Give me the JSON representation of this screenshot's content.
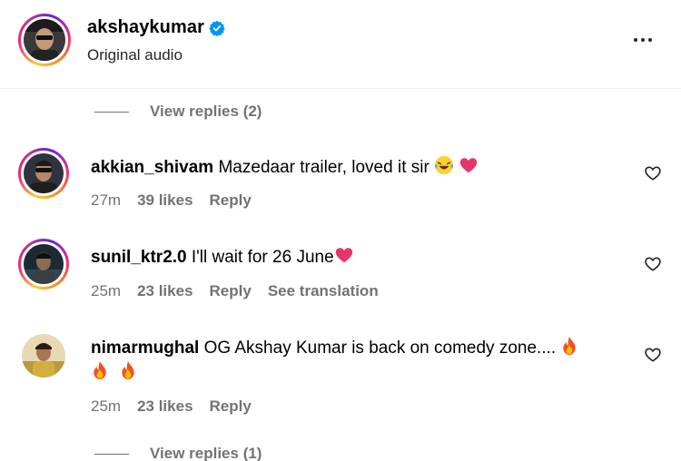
{
  "post": {
    "author": "akshaykumar",
    "subtitle": "Original audio"
  },
  "top_view_replies": "View replies (2)",
  "comments": [
    {
      "username": "akkian_shivam",
      "text": "Mazedaar trailer, loved it sir",
      "emojis": [
        "laughing-emoji",
        "heart-emoji"
      ],
      "time": "27m",
      "likes": "39 likes",
      "reply": "Reply"
    },
    {
      "username": "sunil_ktr2.0",
      "text": "I'll wait for 26 June",
      "emojis": [
        "heart-emoji"
      ],
      "time": "25m",
      "likes": "23 likes",
      "reply": "Reply",
      "translation": "See translation"
    },
    {
      "username": "nimarmughal",
      "text": "OG Akshay Kumar is back on comedy zone....",
      "emojis": [
        "fire-emoji",
        "fire-emoji",
        "fire-emoji"
      ],
      "time": "25m",
      "likes": "23 likes",
      "reply": "Reply"
    }
  ],
  "bottom_view_replies": "View replies (1)",
  "colors": {
    "secondary_text": "#737373",
    "verified_blue": "#0095f6",
    "heart_pink": "#e8336b"
  }
}
